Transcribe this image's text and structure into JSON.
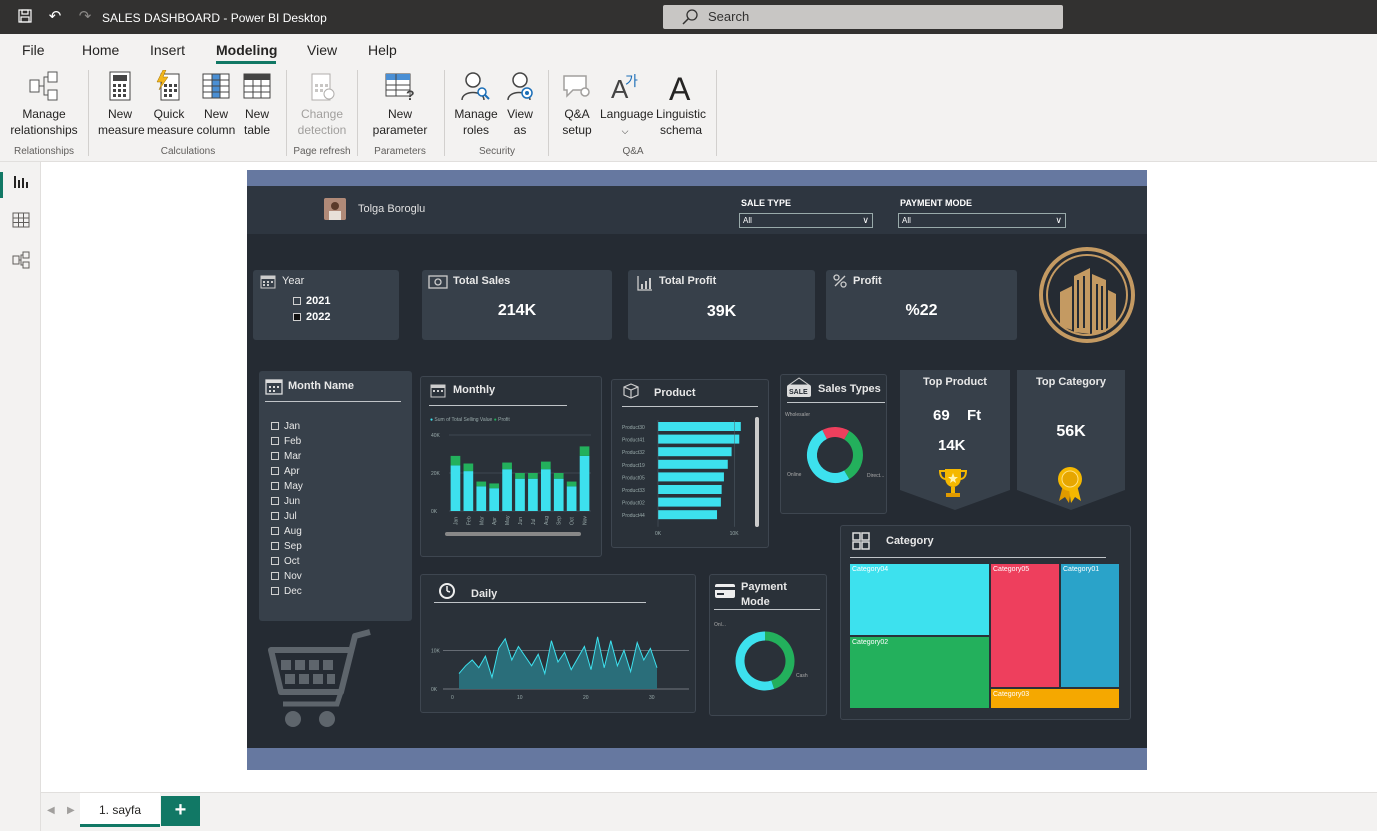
{
  "window": {
    "title": "SALES DASHBOARD - Power BI Desktop",
    "search_placeholder": "Search"
  },
  "menu": {
    "file": "File",
    "home": "Home",
    "insert": "Insert",
    "modeling": "Modeling",
    "view": "View",
    "help": "Help"
  },
  "ribbon": {
    "manage_relationships": "Manage relationships",
    "new_measure": "New measure",
    "quick_measure": "Quick measure",
    "new_column": "New column",
    "new_table": "New table",
    "change_detection": "Change detection",
    "new_parameter": "New parameter",
    "manage_roles": "Manage roles",
    "view_as": "View as",
    "qa_setup": "Q&A setup",
    "language": "Language",
    "linguistic_schema": "Linguistic schema",
    "groups": {
      "relationships": "Relationships",
      "calculations": "Calculations",
      "page_refresh": "Page refresh",
      "parameters": "Parameters",
      "security": "Security",
      "qa": "Q&A"
    }
  },
  "report": {
    "user_name": "Tolga Boroglu",
    "sale_type_label": "SALE TYPE",
    "sale_type_value": "All",
    "payment_mode_label": "PAYMENT MODE",
    "payment_mode_value": "All",
    "year": {
      "title": "Year",
      "options": [
        "2021",
        "2022"
      ]
    },
    "total_sales": {
      "title": "Total Sales",
      "value": "214K"
    },
    "total_profit": {
      "title": "Total Profit",
      "value": "39K"
    },
    "profit": {
      "title": "Profit",
      "value": "%22"
    },
    "month_name": {
      "title": "Month Name",
      "months": [
        "Jan",
        "Feb",
        "Mar",
        "Apr",
        "May",
        "Jun",
        "Jul",
        "Aug",
        "Sep",
        "Oct",
        "Nov",
        "Dec"
      ]
    },
    "monthly": {
      "title": "Monthly",
      "legend1": "Sum of Total Selling Value",
      "legend2": "Profit"
    },
    "product": {
      "title": "Product"
    },
    "sales_types": {
      "title": "Sales Types",
      "wholesaler": "Wholesaler",
      "online": "Online",
      "direct": "Direct..."
    },
    "top_product": {
      "title": "Top Product",
      "line1a": "69",
      "line1b": "Ft",
      "line2": "14K"
    },
    "top_category": {
      "title": "Top Category",
      "value": "56K"
    },
    "daily": {
      "title": "Daily"
    },
    "payment_mode": {
      "title_line1": "Payment",
      "title_line2": "Mode",
      "onl": "Onl...",
      "cash": "Cash"
    },
    "category": {
      "title": "Category",
      "cells": [
        "Category04",
        "Category05",
        "Category01",
        "Category02",
        "Category03"
      ]
    }
  },
  "chart_data": [
    {
      "type": "bar",
      "title": "Monthly",
      "categories": [
        "Jan",
        "Feb",
        "Mar",
        "Apr",
        "May",
        "Jun",
        "Jul",
        "Aug",
        "Sep",
        "Oct",
        "Nov"
      ],
      "series": [
        {
          "name": "Sum of Total Selling Value",
          "values": [
            24000,
            21000,
            13000,
            12000,
            22000,
            17000,
            17000,
            22000,
            17000,
            13000,
            29000
          ]
        },
        {
          "name": "Profit",
          "values": [
            5000,
            4000,
            2500,
            2500,
            3500,
            3000,
            3000,
            4000,
            3000,
            2500,
            5000
          ]
        }
      ],
      "yticks": [
        "0K",
        "20K",
        "40K"
      ],
      "ylim": [
        0,
        40000
      ],
      "colors": [
        "#3de1ee",
        "#23b05c"
      ]
    },
    {
      "type": "bar",
      "title": "Product",
      "orientation": "horizontal",
      "categories": [
        "Product30",
        "Product41",
        "Product32",
        "Product19",
        "Product05",
        "Product33",
        "Product02",
        "Product44"
      ],
      "values": [
        10800,
        10600,
        9600,
        9100,
        8600,
        8300,
        8200,
        7700
      ],
      "xticks": [
        "0K",
        "10K"
      ],
      "xlim": [
        0,
        12000
      ],
      "color": "#3de1ee"
    },
    {
      "type": "pie",
      "title": "Sales Types",
      "categories": [
        "Wholesaler",
        "Online",
        "Direct..."
      ],
      "values": [
        16,
        33,
        51
      ],
      "colors": [
        "#ee3f5d",
        "#23b05c",
        "#3de1ee"
      ]
    },
    {
      "type": "area",
      "title": "Daily",
      "x": [
        1,
        2,
        3,
        4,
        5,
        6,
        7,
        8,
        9,
        10,
        11,
        12,
        13,
        14,
        15,
        16,
        17,
        18,
        19,
        20,
        21,
        22,
        23,
        24,
        25,
        26,
        27,
        28,
        29,
        30,
        31
      ],
      "values": [
        4000,
        6000,
        7500,
        5500,
        8500,
        3000,
        10500,
        13000,
        7500,
        11000,
        8500,
        6000,
        9000,
        4000,
        12500,
        7000,
        9500,
        5000,
        8000,
        11000,
        5000,
        13500,
        5500,
        12500,
        6000,
        10000,
        4500,
        12000,
        7500,
        10500,
        5500
      ],
      "xticks": [
        "0",
        "10",
        "20",
        "30"
      ],
      "yticks": [
        "0K",
        "10K"
      ],
      "ylim": [
        0,
        15000
      ],
      "color": "#2a6e7a",
      "line_color": "#3de1ee"
    },
    {
      "type": "pie",
      "title": "Payment Mode",
      "categories": [
        "Onl...",
        "Cash"
      ],
      "values": [
        45,
        55
      ],
      "colors": [
        "#23b05c",
        "#3de1ee"
      ]
    },
    {
      "type": "heatmap",
      "subtype": "treemap",
      "title": "Category",
      "categories": [
        "Category04",
        "Category05",
        "Category01",
        "Category02",
        "Category03"
      ],
      "colors": [
        "#3de1ee",
        "#ee3f5d",
        "#2aa3c9",
        "#23b05c",
        "#f5a800"
      ]
    }
  ],
  "page": {
    "tab": "1. sayfa",
    "add": "+"
  }
}
